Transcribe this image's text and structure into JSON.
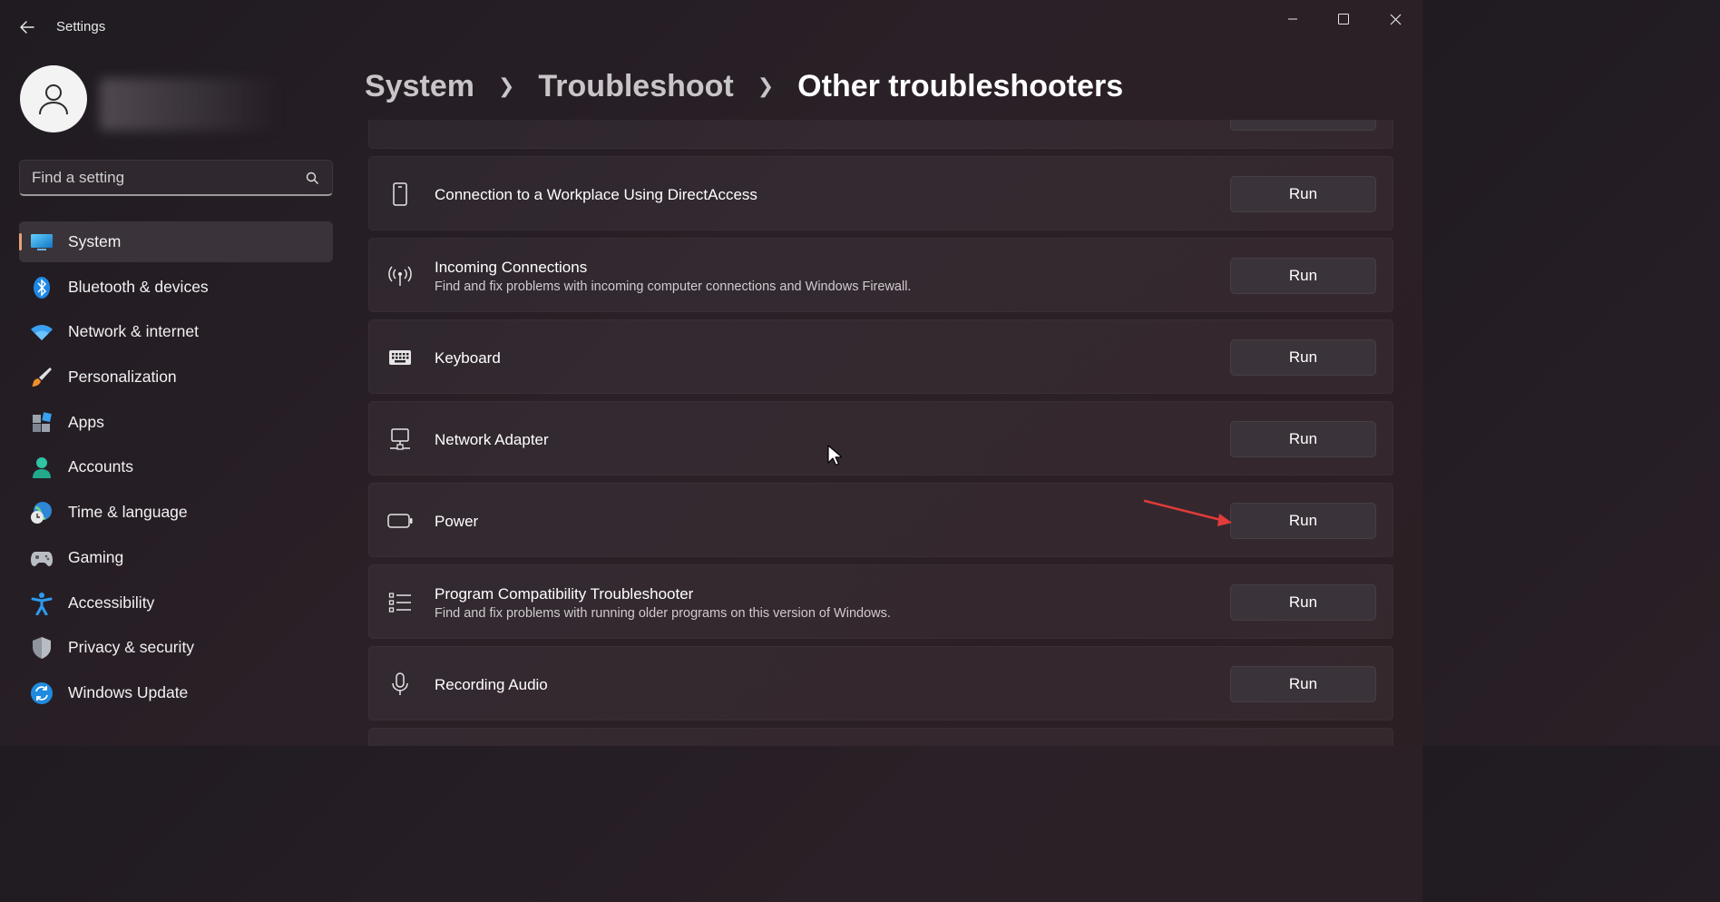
{
  "window": {
    "title": "Settings",
    "controls": [
      "minimize",
      "maximize",
      "close"
    ]
  },
  "sidebar": {
    "search_placeholder": "Find a setting",
    "items": [
      {
        "label": "System",
        "icon": "system-icon",
        "active": true
      },
      {
        "label": "Bluetooth & devices",
        "icon": "bluetooth-icon"
      },
      {
        "label": "Network & internet",
        "icon": "wifi-icon"
      },
      {
        "label": "Personalization",
        "icon": "brush-icon"
      },
      {
        "label": "Apps",
        "icon": "apps-icon"
      },
      {
        "label": "Accounts",
        "icon": "person-icon"
      },
      {
        "label": "Time & language",
        "icon": "globe-clock-icon"
      },
      {
        "label": "Gaming",
        "icon": "gamepad-icon"
      },
      {
        "label": "Accessibility",
        "icon": "accessibility-icon"
      },
      {
        "label": "Privacy & security",
        "icon": "shield-icon"
      },
      {
        "label": "Windows Update",
        "icon": "update-icon"
      }
    ]
  },
  "header": {
    "breadcrumb": [
      "System",
      "Troubleshoot",
      "Other troubleshooters"
    ]
  },
  "troubleshooters": [
    {
      "title": "Connection to a Workplace Using DirectAccess",
      "desc": "",
      "icon": "phone-device-icon",
      "button": "Run"
    },
    {
      "title": "Incoming Connections",
      "desc": "Find and fix problems with incoming computer connections and Windows Firewall.",
      "icon": "antenna-icon",
      "button": "Run"
    },
    {
      "title": "Keyboard",
      "desc": "",
      "icon": "keyboard-icon",
      "button": "Run"
    },
    {
      "title": "Network Adapter",
      "desc": "",
      "icon": "network-adapter-icon",
      "button": "Run"
    },
    {
      "title": "Power",
      "desc": "",
      "icon": "battery-icon",
      "button": "Run"
    },
    {
      "title": "Program Compatibility Troubleshooter",
      "desc": "Find and fix problems with running older programs on this version of Windows.",
      "icon": "list-icon",
      "button": "Run"
    },
    {
      "title": "Recording Audio",
      "desc": "",
      "icon": "microphone-icon",
      "button": "Run"
    }
  ],
  "colors": {
    "accent": "#e9a07a",
    "annotation_arrow": "#e23b3b"
  }
}
